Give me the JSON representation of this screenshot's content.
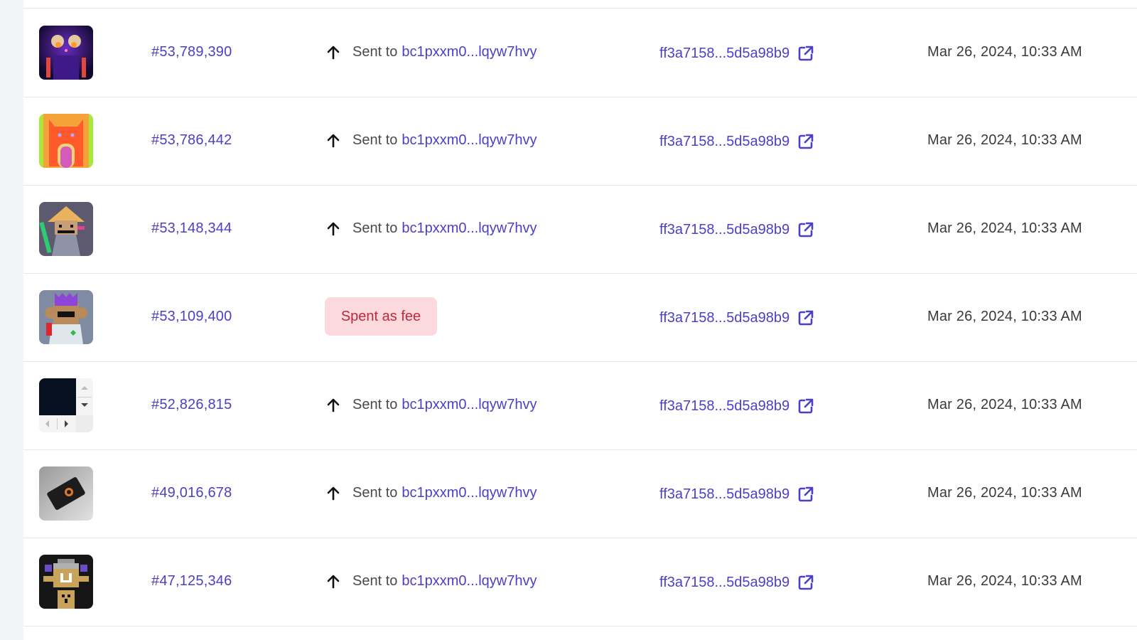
{
  "colors": {
    "link": "#4b3fc7",
    "fee_badge_bg": "#fcd9dc",
    "fee_badge_text": "#c0283c"
  },
  "rows": [
    {
      "thumbnail_icon": "neon-cat-inscription-image",
      "inscription": "#53,789,390",
      "type": "sent",
      "sent_label": "Sent to",
      "address": "bc1pxxm0...lqyw7hvy",
      "txid": "ff3a7158...5d5a98b9",
      "date": "Mar 26, 2024, 10:33 AM"
    },
    {
      "thumbnail_icon": "orange-cat-inscription-image",
      "inscription": "#53,786,442",
      "type": "sent",
      "sent_label": "Sent to",
      "address": "bc1pxxm0...lqyw7hvy",
      "txid": "ff3a7158...5d5a98b9",
      "date": "Mar 26, 2024, 10:33 AM"
    },
    {
      "thumbnail_icon": "pixel-monk-inscription-image",
      "inscription": "#53,148,344",
      "type": "sent",
      "sent_label": "Sent to",
      "address": "bc1pxxm0...lqyw7hvy",
      "txid": "ff3a7158...5d5a98b9",
      "date": "Mar 26, 2024, 10:33 AM"
    },
    {
      "thumbnail_icon": "pixel-monkey-inscription-image",
      "inscription": "#53,109,400",
      "type": "fee",
      "fee_label": "Spent as fee",
      "txid": "ff3a7158...5d5a98b9",
      "date": "Mar 26, 2024, 10:33 AM"
    },
    {
      "thumbnail_icon": "scrollable-frame-inscription-image",
      "inscription": "#52,826,815",
      "type": "sent",
      "sent_label": "Sent to",
      "address": "bc1pxxm0...lqyw7hvy",
      "txid": "ff3a7158...5d5a98b9",
      "date": "Mar 26, 2024, 10:33 AM"
    },
    {
      "thumbnail_icon": "black-card-inscription-image",
      "inscription": "#49,016,678",
      "type": "sent",
      "sent_label": "Sent to",
      "address": "bc1pxxm0...lqyw7hvy",
      "txid": "ff3a7158...5d5a98b9",
      "date": "Mar 26, 2024, 10:33 AM"
    },
    {
      "thumbnail_icon": "pixel-robot-inscription-image",
      "inscription": "#47,125,346",
      "type": "sent",
      "sent_label": "Sent to",
      "address": "bc1pxxm0...lqyw7hvy",
      "txid": "ff3a7158...5d5a98b9",
      "date": "Mar 26, 2024, 10:33 AM"
    }
  ]
}
